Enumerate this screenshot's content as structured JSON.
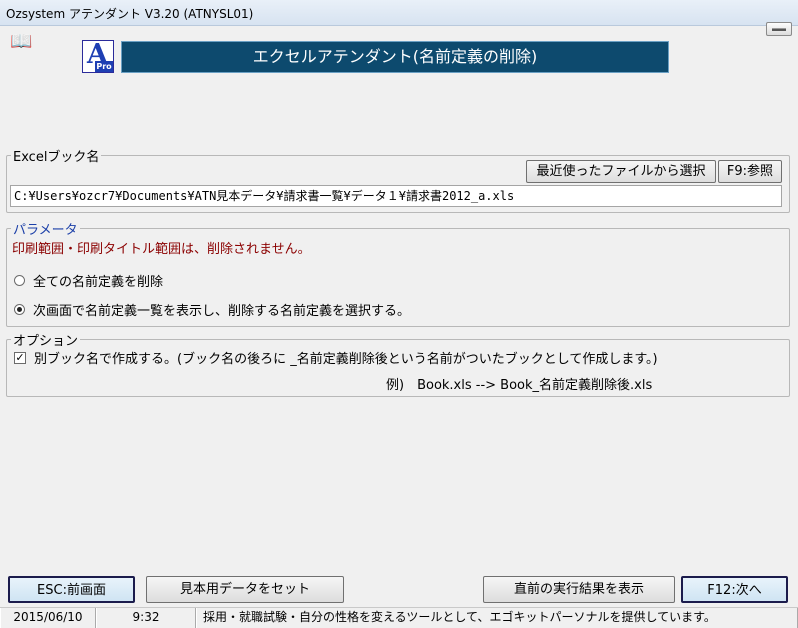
{
  "window": {
    "title": "Ozsystem アテンダント V3.20 (ATNYSL01)"
  },
  "header": {
    "logo_letter": "A",
    "logo_badge": "Pro",
    "banner_title": "エクセルアテンダント(名前定義の削除)"
  },
  "excel_book": {
    "legend": "Excelブック名",
    "recent_button": "最近使ったファイルから選択",
    "browse_button": "F9:参照",
    "path_value": "C:¥Users¥ozcr7¥Documents¥ATN見本データ¥請求書一覧¥データ１¥請求書2012_a.xls"
  },
  "parameters": {
    "legend": "パラメータ",
    "note": "印刷範囲・印刷タイトル範囲は、削除されません。",
    "option_all": "全ての名前定義を削除",
    "option_select": "次画面で名前定義一覧を表示し、削除する名前定義を選択する。",
    "selected": "option_select"
  },
  "options": {
    "legend": "オプション",
    "separate_book_label": "別ブック名で作成する。(ブック名の後ろに _名前定義削除後という名前がついたブックとして作成します。)",
    "separate_book_checked": true,
    "example_text": "例)　Book.xls --> Book_名前定義削除後.xls"
  },
  "footer_buttons": {
    "esc": "ESC:前画面",
    "sample": "見本用データをセット",
    "previous_result": "直前の実行結果を表示",
    "next": "F12:次へ"
  },
  "status": {
    "date": "2015/06/10",
    "time": "9:32",
    "message": "採用・就職試験・自分の性格を変えるツールとして、エゴキットパーソナルを提供しています。"
  }
}
